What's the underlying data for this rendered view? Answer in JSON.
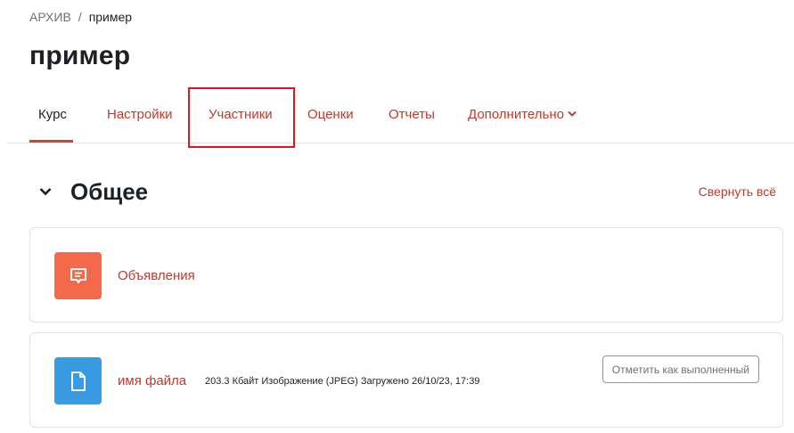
{
  "breadcrumb": {
    "parent": "АРХИВ",
    "separator": "/",
    "current": "пример"
  },
  "page_title": "пример",
  "tabs": [
    {
      "label": "Курс",
      "active": true
    },
    {
      "label": "Настройки",
      "active": false
    },
    {
      "label": "Участники",
      "active": false,
      "highlighted": true
    },
    {
      "label": "Оценки",
      "active": false
    },
    {
      "label": "Отчеты",
      "active": false
    },
    {
      "label": "Дополнительно",
      "active": false,
      "has_dropdown": true
    }
  ],
  "section": {
    "title": "Общее",
    "collapse_all": "Свернуть всё"
  },
  "activities": [
    {
      "name": "Объявления",
      "icon": "forum-icon",
      "icon_color": "#f3694a"
    },
    {
      "name": "имя файла",
      "icon": "file-icon",
      "icon_color": "#399be2",
      "details": "203.3 Кбайт Изображение (JPEG) Загружено 26/10/23, 17:39",
      "completion_button": "Отметить как выполненный"
    }
  ],
  "colors": {
    "link": "#c0392b",
    "text": "#1d2125",
    "muted": "#6a737b",
    "highlight": "#e0141e"
  }
}
